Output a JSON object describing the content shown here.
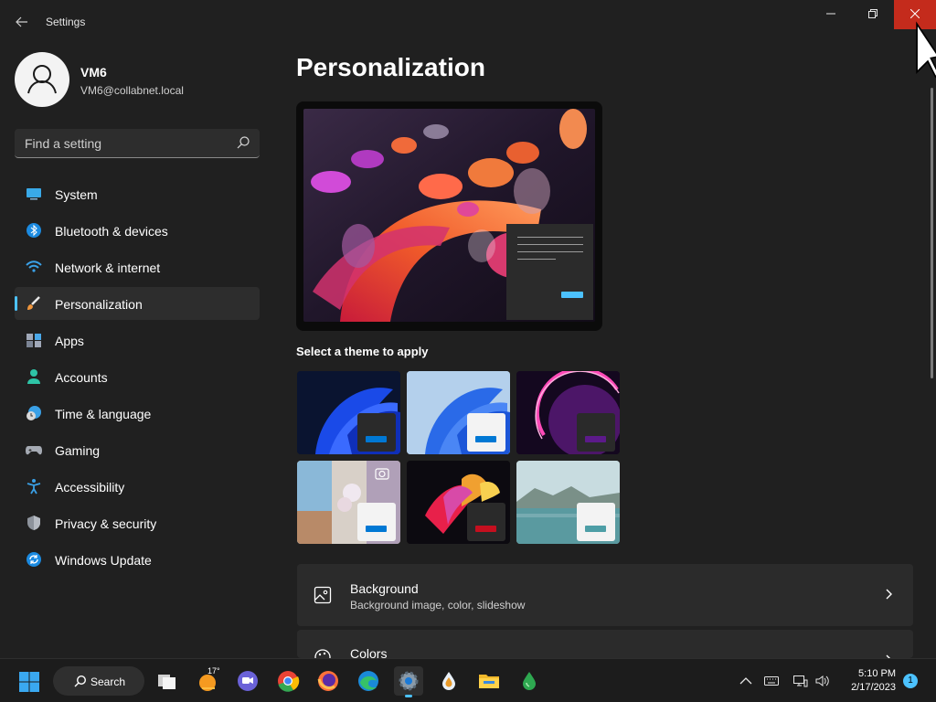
{
  "window": {
    "title": "Settings",
    "back_icon": "back-arrow-icon",
    "controls": [
      "minimize-icon",
      "maximize-icon",
      "close-icon"
    ],
    "close_hover_color": "#c42b1c"
  },
  "profile": {
    "name": "VM6",
    "email": "VM6@collabnet.local"
  },
  "search": {
    "placeholder": "Find a setting"
  },
  "sidebar": {
    "accent": "#4cc2ff",
    "items": [
      {
        "label": "System",
        "icon": "monitor-icon",
        "active": false
      },
      {
        "label": "Bluetooth & devices",
        "icon": "bluetooth-icon",
        "active": false
      },
      {
        "label": "Network & internet",
        "icon": "wifi-icon",
        "active": false
      },
      {
        "label": "Personalization",
        "icon": "paintbrush-icon",
        "active": true
      },
      {
        "label": "Apps",
        "icon": "apps-icon",
        "active": false
      },
      {
        "label": "Accounts",
        "icon": "person-icon",
        "active": false
      },
      {
        "label": "Time & language",
        "icon": "clock-globe-icon",
        "active": false
      },
      {
        "label": "Gaming",
        "icon": "gamepad-icon",
        "active": false
      },
      {
        "label": "Accessibility",
        "icon": "accessibility-icon",
        "active": false
      },
      {
        "label": "Privacy & security",
        "icon": "shield-icon",
        "active": false
      },
      {
        "label": "Windows Update",
        "icon": "update-icon",
        "active": false
      }
    ]
  },
  "main": {
    "title": "Personalization",
    "themes_heading": "Select a theme to apply",
    "themes": [
      {
        "name": "windows-dark",
        "bar_color": "#0078d4"
      },
      {
        "name": "windows-light",
        "bar_color": "#0078d4"
      },
      {
        "name": "glow",
        "bar_color": "#5c1a8a"
      },
      {
        "name": "captured-motion",
        "bar_color": "#0078d4"
      },
      {
        "name": "flow",
        "bar_color": "#c50f1f"
      },
      {
        "name": "sunrise",
        "bar_color": "#4d9ea6"
      }
    ],
    "cards": [
      {
        "title": "Background",
        "subtitle": "Background image, color, slideshow",
        "icon": "image-icon"
      },
      {
        "title": "Colors",
        "subtitle": "",
        "icon": "palette-icon"
      }
    ]
  },
  "taskbar": {
    "search_label": "Search",
    "weather_temp": "17°",
    "apps": [
      "task-view-icon",
      "weather-icon",
      "teams-chat-icon",
      "chrome-icon",
      "firefox-icon",
      "edge-icon",
      "settings-icon",
      "water-drop-icon",
      "file-explorer-icon",
      "green-drop-icon"
    ],
    "active_app": "settings-icon",
    "time": "5:10 PM",
    "date": "2/17/2023",
    "notification_count": "1"
  }
}
